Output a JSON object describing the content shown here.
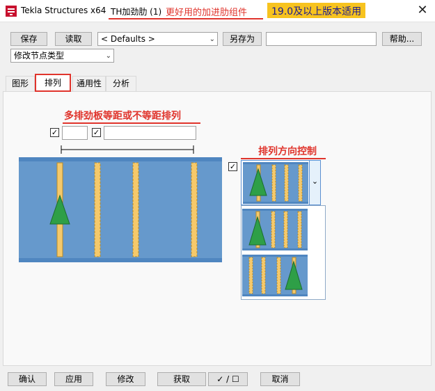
{
  "window": {
    "app_title": "Tekla Structures x64",
    "connection_name": "TH加劲肋 (1)",
    "promo_red": "更好用的加进肋组件",
    "promo_yellow": "19.0及以上版本适用",
    "close_glyph": "✕"
  },
  "toolbar": {
    "save_label": "保存",
    "load_label": "读取",
    "preset_value": "< Defaults >",
    "save_as_label": "另存为",
    "save_as_value": "",
    "help_label": "帮助..."
  },
  "node_type": {
    "value": "修改节点类型"
  },
  "tabs": [
    {
      "label": "图形"
    },
    {
      "label": "排列"
    },
    {
      "label": "通用性"
    },
    {
      "label": "分析"
    }
  ],
  "annotations": {
    "spacing_note": "多排劲板等距或不等距排列",
    "direction_note": "排列方向控制"
  },
  "spacing": {
    "count_value": "",
    "distances_value": "",
    "count_checked": true,
    "distances_checked": true
  },
  "direction": {
    "checked": true,
    "options": [
      "left-arrow-first",
      "left-arrow-second",
      "right-arrow-last"
    ],
    "selected": "left-arrow-first"
  },
  "colors": {
    "plate_blue": "#6699cc",
    "stiffener_yellow": "#f5c96b",
    "arrow_green": "#2e9f47",
    "annotation_red": "#e0342c"
  },
  "bottom": {
    "ok_label": "确认",
    "apply_label": "应用",
    "modify_label": "修改",
    "get_label": "获取",
    "toggle_label": "✓ / ☐",
    "cancel_label": "取消"
  },
  "check_glyph": "✓"
}
